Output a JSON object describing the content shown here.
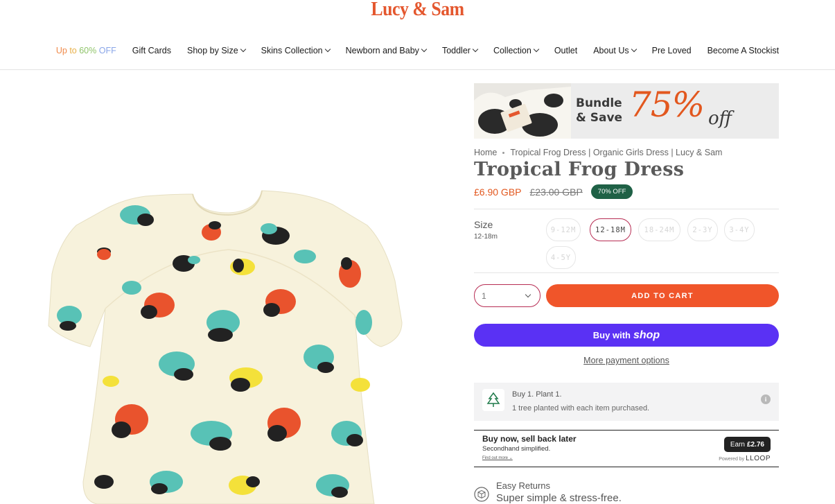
{
  "header": {
    "logo": "Lucy & Sam",
    "nav": [
      {
        "label": "Up to 60% OFF",
        "dropdown": false,
        "sale": true
      },
      {
        "label": "Gift Cards",
        "dropdown": false
      },
      {
        "label": "Shop by Size",
        "dropdown": true
      },
      {
        "label": "Skins Collection",
        "dropdown": true
      },
      {
        "label": "Newborn and Baby",
        "dropdown": true
      },
      {
        "label": "Toddler",
        "dropdown": true
      },
      {
        "label": "Collection",
        "dropdown": true
      },
      {
        "label": "Outlet",
        "dropdown": false
      },
      {
        "label": "About Us",
        "dropdown": true
      },
      {
        "label": "Pre Loved",
        "dropdown": false
      },
      {
        "label": "Become A Stockist",
        "dropdown": false
      }
    ]
  },
  "banner": {
    "line1": "Bundle",
    "line2": "& Save",
    "percent": "75%",
    "off": "off",
    "colors": {
      "accent": "#e2571e"
    }
  },
  "breadcrumb": {
    "home": "Home",
    "current": "Tropical Frog Dress | Organic Girls Dress | Lucy & Sam"
  },
  "product": {
    "title": "Tropical Frog Dress",
    "price": "£6.90 GBP",
    "compare_price": "£23.00 GBP",
    "badge": "70% OFF",
    "size_label": "Size",
    "size_selected": "12-18m",
    "sizes": [
      {
        "label": "9-12M",
        "available": false
      },
      {
        "label": "12-18M",
        "available": true,
        "selected": true
      },
      {
        "label": "18-24M",
        "available": false
      },
      {
        "label": "2-3Y",
        "available": false
      },
      {
        "label": "3-4Y",
        "available": false
      },
      {
        "label": "4-5Y",
        "available": false
      }
    ],
    "quantity": "1",
    "add_to_cart": "ADD TO CART",
    "buy_with": "Buy with",
    "buy_brand": "shop",
    "more_payment": "More payment options"
  },
  "plant": {
    "title": "Buy 1. Plant 1.",
    "subtitle": "1 tree planted with each item purchased.",
    "info_icon": "i"
  },
  "loop": {
    "title": "Buy now, sell back later",
    "subtitle": "Secondhand simplified.",
    "link": "Find out more",
    "earn_label": "Earn",
    "earn_value": "£2.76",
    "powered_label": "Powered by",
    "powered_brand": "LLOOP"
  },
  "returns": {
    "title": "Easy Returns",
    "subtitle": "Super simple & stress-free."
  }
}
